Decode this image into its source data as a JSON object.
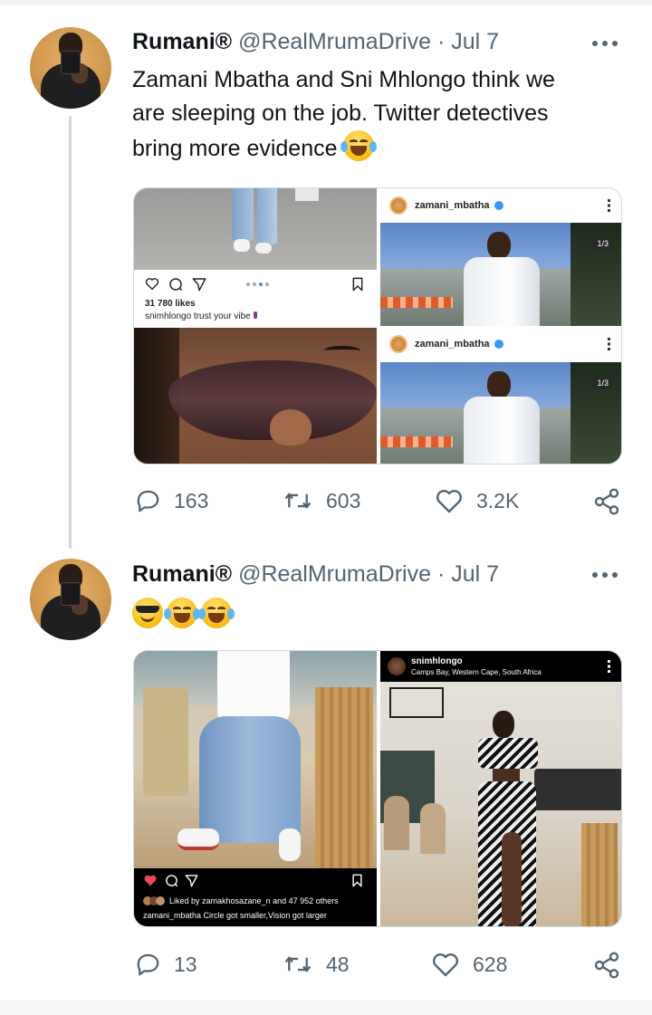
{
  "tweets": [
    {
      "name": "Rumani®",
      "handle": "@RealMrumaDrive",
      "separator": "·",
      "date": "Jul 7",
      "text_lines": [
        "Zamani Mbatha and Sni Mhlongo think we",
        "are sleeping on the job. Twitter detectives",
        "bring more evidence"
      ],
      "emoji_after_text": [
        "face-with-tears-of-joy"
      ],
      "media": {
        "panel_1": {
          "likes": "31 780 likes",
          "caption": "snimhlongo trust your vibe"
        },
        "panel_2": {
          "username": "zamani_mbatha",
          "counter": "1/3"
        },
        "panel_3": {
          "username": "zamani_mbatha",
          "counter": "1/3"
        }
      },
      "stats": {
        "replies": "163",
        "retweets": "603",
        "likes": "3.2K"
      }
    },
    {
      "name": "Rumani®",
      "handle": "@RealMrumaDrive",
      "separator": "·",
      "date": "Jul 7",
      "emojis": [
        "smiling-face-with-sunglasses",
        "face-with-tears-of-joy",
        "face-with-tears-of-joy"
      ],
      "media": {
        "left": {
          "liked_by": "Liked by zamakhosazane_n and 47 952 others",
          "caption": "zamani_mbatha Circle got smaller,Vision got larger"
        },
        "right": {
          "username": "snimhlongo",
          "location": "Camps Bay, Western Cape, South Africa"
        }
      },
      "stats": {
        "replies": "13",
        "retweets": "48",
        "likes": "628"
      }
    }
  ],
  "colors": {
    "secondary_text": "#536471",
    "divider": "#cfd9de",
    "ig_heart": "#ed4956",
    "verified": "#3897f0"
  }
}
